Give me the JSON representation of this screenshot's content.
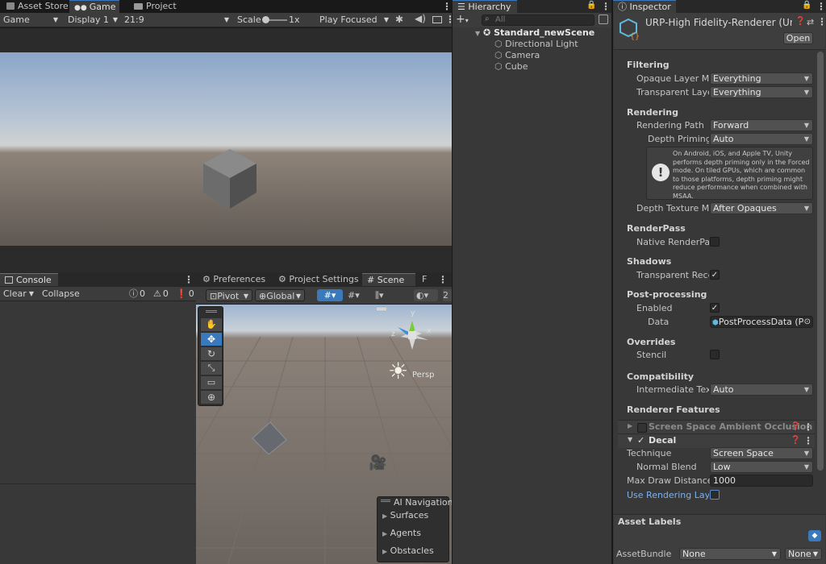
{
  "top_tabs": {
    "asset_store": "Asset Store",
    "game": "Game",
    "project": "Project"
  },
  "game_toolbar": {
    "mode": "Game",
    "display": "Display 1",
    "aspect": "21:9",
    "scale_label": "Scale",
    "scale_value": "1x",
    "play_mode": "Play Focused"
  },
  "console": {
    "tab": "Console",
    "clear": "Clear",
    "collapse": "Collapse",
    "info_count": "0",
    "warn_count": "0",
    "error_count": "0"
  },
  "scene_tabs": {
    "preferences": "Preferences",
    "project_settings": "Project Settings",
    "scene": "Scene",
    "overflow": "F"
  },
  "scene_toolbar": {
    "pivot": "Pivot",
    "global": "Global",
    "right_num": "2"
  },
  "scene_view": {
    "persp": "Persp",
    "axis_y": "y",
    "axis_x": "x",
    "axis_z": "z",
    "overlay_title": "AI Navigation",
    "overlay_items": [
      "Surfaces",
      "Agents",
      "Obstacles"
    ]
  },
  "hierarchy": {
    "tab": "Hierarchy",
    "search_placeholder": "All",
    "scene_name": "Standard_newScene",
    "items": [
      "Directional Light",
      "Camera",
      "Cube"
    ]
  },
  "inspector": {
    "tab": "Inspector",
    "asset_name": "URP-High Fidelity-Renderer (Univ",
    "open_button": "Open",
    "filtering_header": "Filtering",
    "opaque_label": "Opaque Layer Mas",
    "opaque_value": "Everything",
    "transparent_label": "Transparent Layer",
    "transparent_value": "Everything",
    "rendering_header": "Rendering",
    "rendering_path_label": "Rendering Path",
    "rendering_path_value": "Forward",
    "depth_priming_label": "Depth Priming M",
    "depth_priming_value": "Auto",
    "help_text": "On Android, iOS, and Apple TV, Unity performs depth priming only in the Forced mode. On tiled GPUs, which are common to those platforms, depth priming might reduce performance when combined with MSAA.",
    "depth_texture_label": "Depth Texture Moc",
    "depth_texture_value": "After Opaques",
    "renderpass_header": "RenderPass",
    "native_renderpass_label": "Native RenderPass",
    "shadows_header": "Shadows",
    "transparent_receive_label": "Transparent Recei",
    "postprocessing_header": "Post-processing",
    "enabled_label": "Enabled",
    "data_label": "Data",
    "data_value": "PostProcessData (Pc",
    "overrides_header": "Overrides",
    "stencil_label": "Stencil",
    "compat_header": "Compatibility",
    "intermediate_label": "Intermediate Textu",
    "intermediate_value": "Auto",
    "renderer_features_header": "Renderer Features",
    "ssao_label": "Screen Space Ambient Occlusion",
    "decal_label": "Decal",
    "technique_label": "Technique",
    "technique_value": "Screen Space",
    "normal_blend_label": "Normal Blend",
    "normal_blend_value": "Low",
    "max_draw_label": "Max Draw Distance",
    "max_draw_value": "1000",
    "use_layers_label": "Use Rendering Layers",
    "asset_labels_header": "Asset Labels",
    "assetbundle_label": "AssetBundle",
    "assetbundle_value": "None",
    "assetbundle_variant": "None"
  }
}
